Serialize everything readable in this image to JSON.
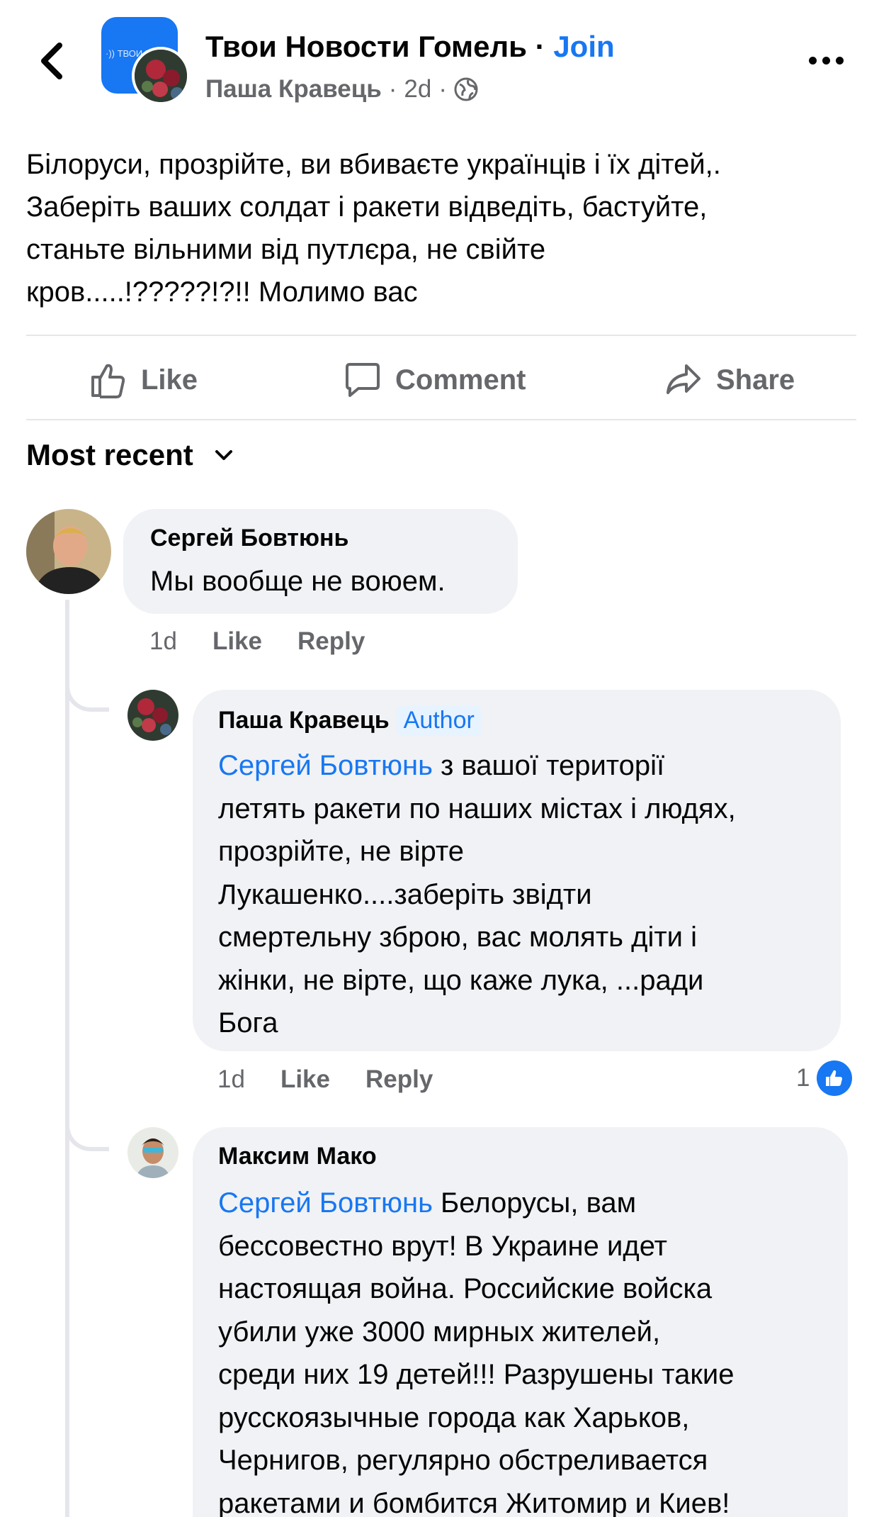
{
  "header": {
    "group_name": "Твои Новости Гомель",
    "separator": "·",
    "join_label": "Join",
    "group_logo_text": "·)) ТВОИ НОВ",
    "poster_name": "Паша Кравець",
    "post_age": "2d",
    "privacy_icon": "globe-icon",
    "colors": {
      "accent": "#1877f2",
      "secondary_text": "#65676b"
    }
  },
  "post": {
    "lines": [
      "Білоруси, прозрійте, ви вбиваєте українців і їх дітей,.",
      "Заберіть ваших солдат і ракети відведіть, бастуйте,",
      "станьте вільними від путлєра, не свійте",
      "кров.....!?????!?!!  Молимо вас"
    ]
  },
  "actions": {
    "like_label": "Like",
    "comment_label": "Comment",
    "share_label": "Share"
  },
  "sort": {
    "label": "Most recent"
  },
  "comments": [
    {
      "author": "Сергей Бовтюнь",
      "lines": [
        "Мы вообще не воюем."
      ],
      "time": "1d",
      "like_label": "Like",
      "reply_label": "Reply"
    }
  ],
  "replies": [
    {
      "author": "Паша Кравець",
      "badge": "Author",
      "mention": "Сергей Бовтюнь",
      "first_line_rest": " з вашої території",
      "lines": [
        "летять ракети по наших містах і людях,",
        "прозрійте, не вірте",
        "Лукашенко....заберіть звідти",
        "смертельну зброю, вас молять діти і",
        "жінки, не вірте, що каже лука, ...ради",
        "Бога"
      ],
      "time": "1d",
      "like_label": "Like",
      "reply_label": "Reply",
      "reaction_count": "1"
    },
    {
      "author": "Максим Мако",
      "mention": "Сергей Бовтюнь",
      "first_line_rest": " Белорусы, вам",
      "lines": [
        "бессовестно врут! В Украине идет",
        "настоящая война. Российские войска",
        "убили уже 3000 мирных жителей,",
        "среди них 19 детей!!! Разрушены такие",
        "русскоязычные города как Харьков,",
        "Чернигов, регулярно обстреливается",
        "ракетами и бомбится Житомир и Киев!"
      ]
    }
  ]
}
